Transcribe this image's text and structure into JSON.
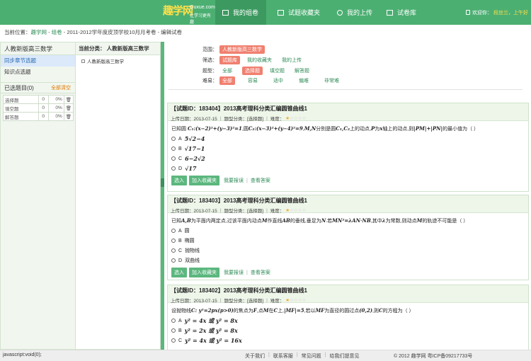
{
  "header": {
    "logo_main": "趣学网",
    "logo_domain": "Quxue.com",
    "logo_sub": "让学习更有趣",
    "nav": [
      "我的组卷",
      "试题收藏夹",
      "我的上传",
      "试卷库"
    ],
    "welcome": "欢迎你：",
    "user_name": "段丝兰，上午好"
  },
  "breadcrumb": {
    "prefix": "当前位置：",
    "home": "趣学网",
    "sep": " - ",
    "section": "组卷",
    "current": "2011-2012学年度皮顶学校10月月考卷 - 编辑试卷"
  },
  "left_panel": {
    "title": "人教新版高三数学",
    "items": [
      "同步章节选题",
      "知识点选题"
    ],
    "selected_label": "已选题目(0)",
    "clear_all": "全部清空",
    "table": [
      {
        "type": "选择题",
        "count": "0",
        "percent": "0%"
      },
      {
        "type": "填空题",
        "count": "0",
        "percent": "0%"
      },
      {
        "type": "解答题",
        "count": "0",
        "percent": "0%"
      }
    ]
  },
  "mid_panel": {
    "title": "当前分类： 人教新版高三数学",
    "node": "人教新版高三数学"
  },
  "filters": {
    "range_label": "范围：",
    "range_value": "人教新版高三数学",
    "filter_label": "筛选：",
    "filter_options": [
      "试题库",
      "我的收藏夹",
      "我的上传"
    ],
    "type_label": "题型：",
    "type_options": [
      "全部",
      "选择题",
      "填空题",
      "解答题"
    ],
    "difficulty_label": "难易：",
    "difficulty_options": [
      "全部",
      "容易",
      "适中",
      "偏难",
      "非常难"
    ]
  },
  "questions": [
    {
      "title": "【试题ID：183404】2013高考理科分类汇编圆锥曲线1",
      "date": "上传日期：2013-07-15",
      "category": "题型分类：[选择题]",
      "difficulty_label": "难度：",
      "stars": 1,
      "stem_1": "已知圆",
      "stem_2": "分别是圆",
      "stem_3": "上的动点,",
      "stem_4": "为",
      "stem_5": "轴上的动点,则",
      "stem_6": "的最小值为（ ）",
      "options": [
        {
          "key": "A",
          "value": "5√2−4"
        },
        {
          "key": "B",
          "value": "√17−1"
        },
        {
          "key": "C",
          "value": "6−2√2"
        },
        {
          "key": "D",
          "value": "√17"
        }
      ],
      "select": "选入",
      "favorite": "加入收藏夹",
      "report": "我要报误",
      "answer": "查看答案"
    },
    {
      "title": "【试题ID：183403】2013高考理科分类汇编圆锥曲线1",
      "date": "上传日期：2013-07-15",
      "category": "题型分类：[选择题]",
      "difficulty_label": "难度：",
      "stars": 1,
      "stem_1": "已知",
      "stem_2": "为平面内两定点,过该平面内动点",
      "stem_3": "作直线",
      "stem_4": "的垂线,垂足为",
      "stem_5": ".若",
      "stem_6": ",其中",
      "stem_7": "为常数,则动点",
      "stem_8": "的轨迹不可能是（ ）",
      "options": [
        {
          "key": "A",
          "value": "圆"
        },
        {
          "key": "B",
          "value": "椭圆"
        },
        {
          "key": "C",
          "value": "抛物线"
        },
        {
          "key": "D",
          "value": "双曲线"
        }
      ],
      "select": "选入",
      "favorite": "加入收藏夹",
      "report": "我要报误",
      "answer": "查看答案"
    },
    {
      "title": "【试题ID：183402】2013高考理科分类汇编圆锥曲线1",
      "date": "上传日期：2013-07-15",
      "category": "题型分类：[选择题]",
      "difficulty_label": "难度：",
      "stars": 1,
      "stem_1": "设抛物线",
      "stem_2": "的焦点为",
      "stem_3": ",点",
      "stem_4": "在",
      "stem_5": "上,",
      "stem_6": ",若以",
      "stem_7": "为直径的圆过点",
      "stem_8": ",则",
      "stem_9": "的方程为（ ）",
      "options": [
        {
          "key": "A",
          "value": "y² = 4x 或 y² = 8x"
        },
        {
          "key": "B",
          "value": "y² = 2x 或 y² = 8x"
        },
        {
          "key": "C",
          "value": "y² = 4x 或 y² = 16x"
        }
      ]
    }
  ],
  "footer": {
    "status": "javascript:void(0);",
    "links": [
      "关于我们",
      "联系客服",
      "常见问题",
      "给我们提意见"
    ],
    "copyright": "© 2012 趣学网 粤ICP备09217733号"
  }
}
